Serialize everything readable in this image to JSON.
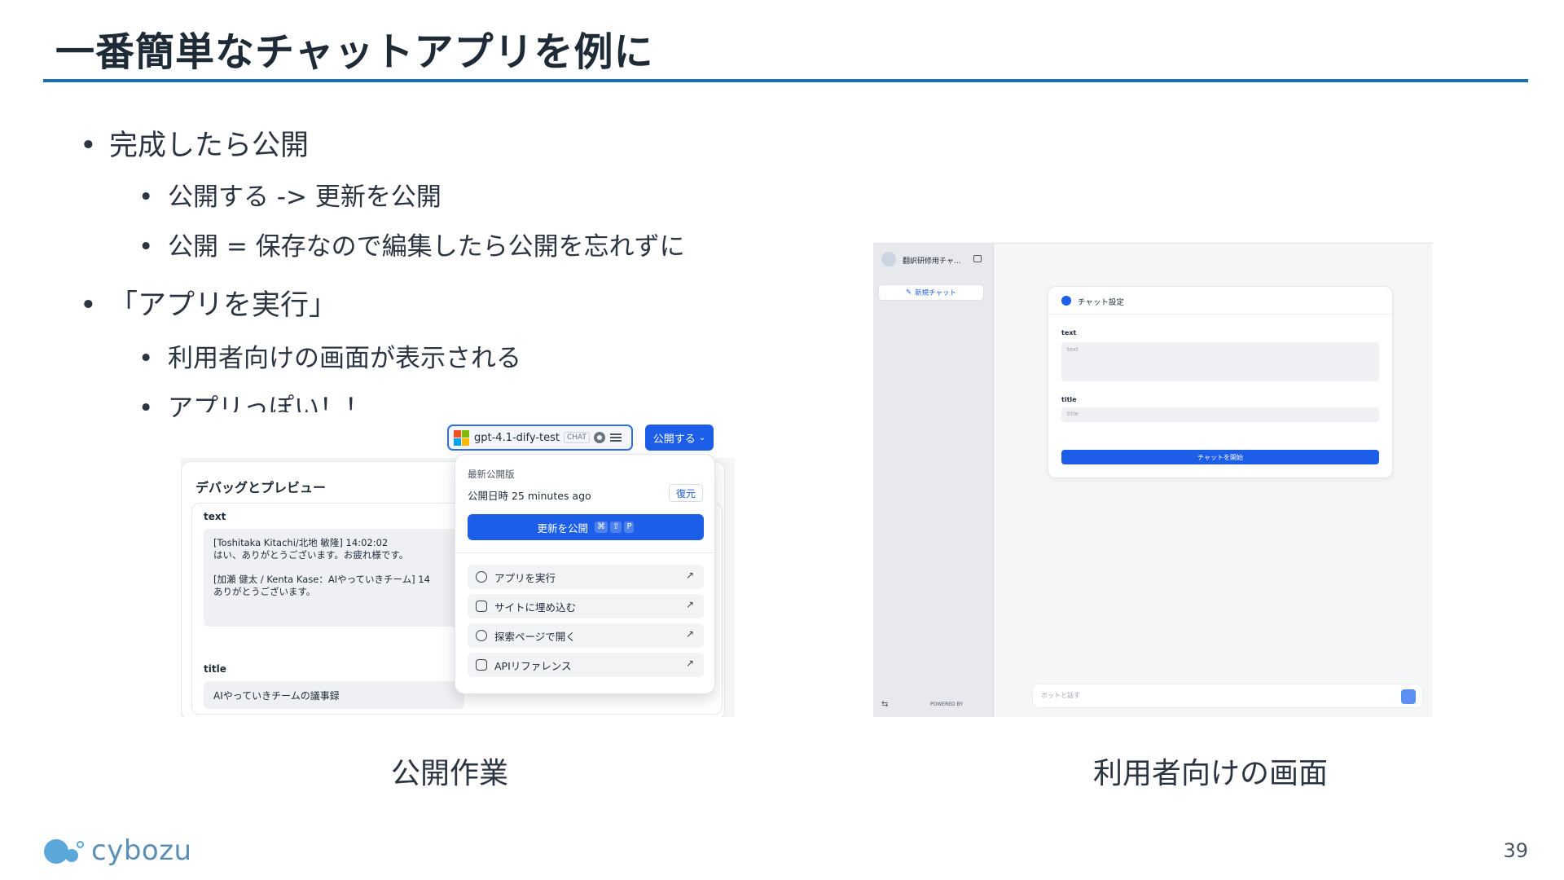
{
  "slide": {
    "title": "一番簡単なチャットアプリを例に",
    "page_number": "39",
    "logo_text": "cybozu",
    "bullets": [
      {
        "level": 1,
        "text": "完成したら公開"
      },
      {
        "level": 2,
        "text": "公開する -> 更新を公開"
      },
      {
        "level": 2,
        "text": "公開 = 保存なので編集したら公開を忘れずに"
      },
      {
        "level": 1,
        "text": "「アプリを実行」"
      },
      {
        "level": 2,
        "text": "利用者向けの画面が表示される"
      },
      {
        "level": 2,
        "text": "アプリっぽい！！"
      }
    ],
    "caption_left": "公開作業",
    "caption_right": "利用者向けの画面"
  },
  "left_shot": {
    "model_name": "gpt-4.1-dify-test",
    "model_tag": "CHAT",
    "publish_label": "公開する",
    "debug_title": "デバッグとプレビュー",
    "text_label": "text",
    "text_value": "[Toshitaka Kitachi/北地 敏隆] 14:02:02\nはい、ありがとうございます。お疲れ様です。\n\n[加瀬 健太 / Kenta Kase：AIやっていきチーム] 14\nありがとうございます。",
    "title_label": "title",
    "title_value": "AIやっていきチームの議事録",
    "dropdown": {
      "header": "最新公開版",
      "published_at": "公開日時 25 minutes ago",
      "restore_label": "復元",
      "update_label": "更新を公開",
      "shortcut": [
        "⌘",
        "⇧",
        "P"
      ],
      "items": [
        {
          "label": "アプリを実行",
          "icon": "play-icon"
        },
        {
          "label": "サイトに埋め込む",
          "icon": "embed-icon"
        },
        {
          "label": "探索ページで開く",
          "icon": "explore-icon"
        },
        {
          "label": "APIリファレンス",
          "icon": "terminal-icon"
        }
      ]
    }
  },
  "right_shot": {
    "app_name": "翻訳研修用チャ…",
    "new_chat_label": "新規チャット",
    "card_title": "チャット設定",
    "text_label": "text",
    "text_placeholder": "text",
    "title_label": "title",
    "title_placeholder": "title",
    "start_label": "チャットを開始",
    "chat_placeholder": "ボットと話す",
    "powered_by": "POWERED BY"
  },
  "colors": {
    "accent": "#1d5ee8",
    "title_rule": "#1b6fb0",
    "logo": "#5aa7d9"
  }
}
